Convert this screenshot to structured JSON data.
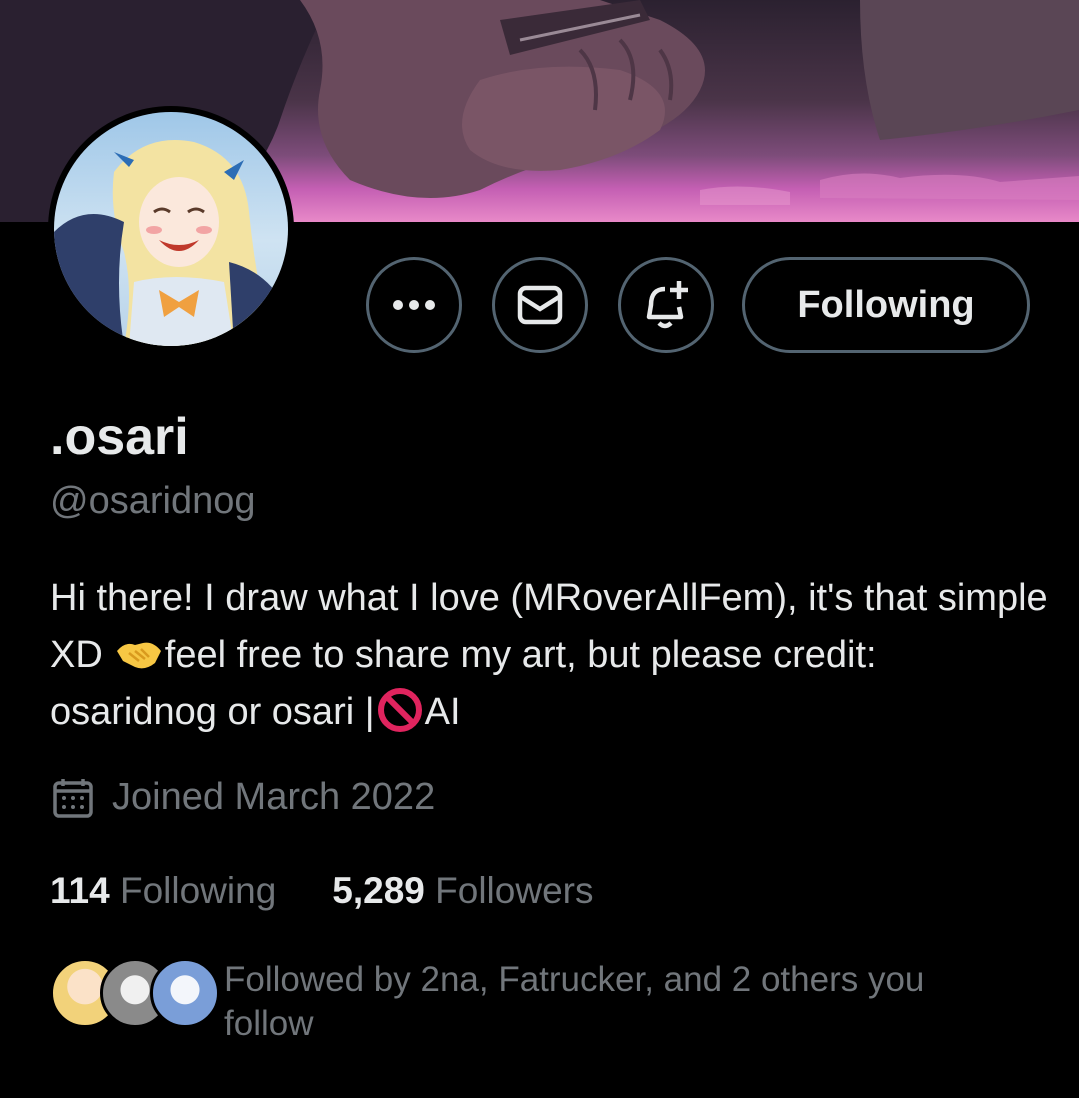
{
  "profile": {
    "display_name": ".osari",
    "handle": "@osaridnog",
    "bio_part1": "Hi there! I draw what I love (MRoverAllFem), it's that simple XD",
    "bio_part2": "feel free to share my art, but please credit: osaridnog or osari |",
    "bio_part3": "AI",
    "joined": "Joined March 2022"
  },
  "actions": {
    "following_label": "Following"
  },
  "stats": {
    "following_count": "114",
    "following_label": "Following",
    "followers_count": "5,289",
    "followers_label": "Followers"
  },
  "followed_by": {
    "text": "Followed by 2na, Fatrucker, and 2 others you follow"
  },
  "colors": {
    "background": "#000000",
    "text_primary": "#e7e9ea",
    "text_secondary": "#71767b",
    "button_border": "#536471"
  },
  "icons": [
    "more-icon",
    "mail-icon",
    "notification-add-icon",
    "calendar-icon",
    "handshake-emoji",
    "prohibited-emoji"
  ]
}
